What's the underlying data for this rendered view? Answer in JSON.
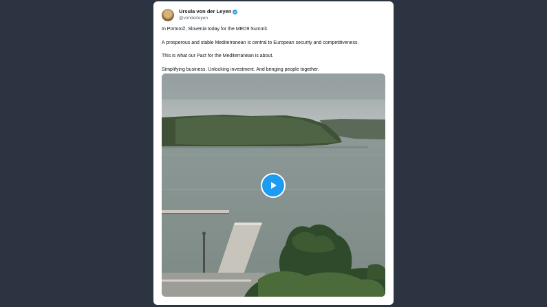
{
  "tweet": {
    "author": {
      "display_name": "Ursula von der Leyen",
      "handle": "@vonderleyen",
      "verified_icon": "verified-badge-icon"
    },
    "paragraphs": [
      "In Portorož, Slovenia today for the MED9 Summit.",
      "A prosperous and stable Mediterranean is central to European security and competitiveness.",
      "This is what our Pact for the Mediterranean is about.",
      "Simplifying business. Unlocking investment. And bringing people together."
    ],
    "media": {
      "type": "video",
      "play_icon": "play-icon"
    }
  },
  "colors": {
    "page_background": "#2c3442",
    "card_background": "#ffffff",
    "accent": "#1d9bf0"
  }
}
